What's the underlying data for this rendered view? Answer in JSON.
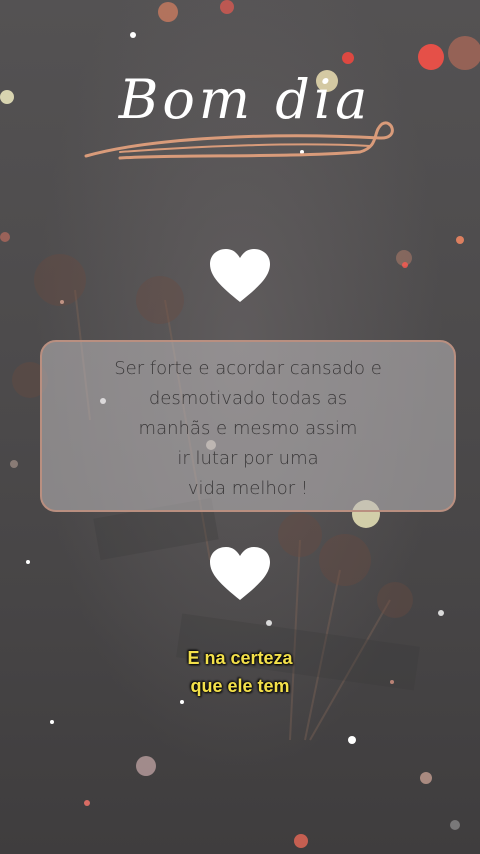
{
  "title": "Bom dia",
  "quote": {
    "lines": [
      "Ser forte e acordar cansado e",
      "desmotivado todas as",
      "manhãs e mesmo assim",
      "ir lutar por uma",
      "vida melhor !"
    ]
  },
  "caption": {
    "lines": [
      "E na certeza",
      "que ele tem"
    ]
  },
  "colors": {
    "heart": "#ffffff",
    "card_border": "#b98f80",
    "swash": "#d99b7a",
    "caption": "#f3e04a"
  }
}
